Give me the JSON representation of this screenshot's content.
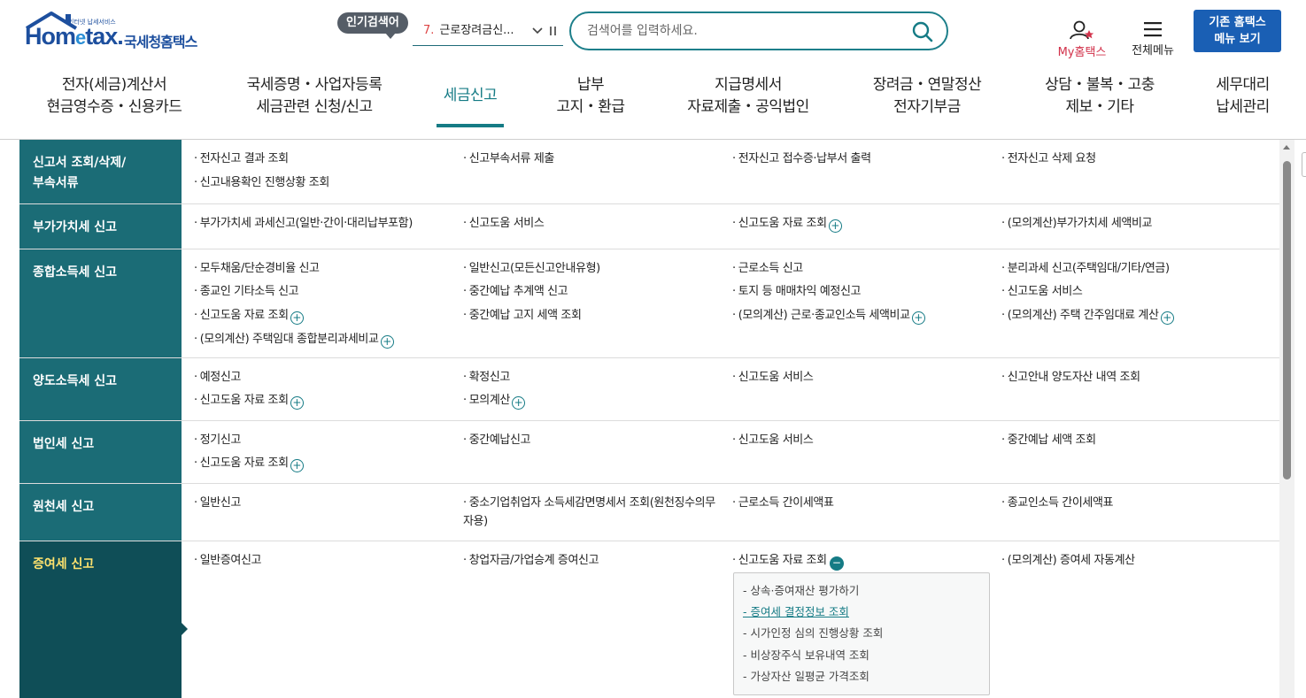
{
  "header": {
    "logo_tag": "인터넷 납세서비스",
    "logo_brand_pre": "Hom",
    "logo_brand_e": "e",
    "logo_brand_post": "tax.",
    "logo_org": "국세청홈택스",
    "popular_badge": "인기검색어",
    "popular_rank": "7.",
    "popular_term": "근로장려금신...",
    "search_placeholder": "검색어를 입력하세요.",
    "my_hometax": "My홈택스",
    "all_menu": "전체메뉴",
    "old_menu_line1": "기존 홈택스",
    "old_menu_line2": "메뉴 보기",
    "colors": {
      "brand": "#1d4f9e",
      "teal": "#157b85",
      "button": "#1a5fb4"
    }
  },
  "gnb": [
    {
      "line1": "전자(세금)계산서",
      "line2": "현금영수증・신용카드"
    },
    {
      "line1": "국세증명・사업자등록",
      "line2": "세금관련 신청/신고"
    },
    {
      "line1": "세금신고",
      "line2": ""
    },
    {
      "line1": "납부",
      "line2": "고지・환급"
    },
    {
      "line1": "지급명세서",
      "line2": "자료제출・공익법인"
    },
    {
      "line1": "장려금・연말정산",
      "line2": "전자기부금"
    },
    {
      "line1": "상담・불복・고충",
      "line2": "제보・기타"
    },
    {
      "line1": "세무대리",
      "line2": "납세관리"
    }
  ],
  "rows": [
    {
      "category": "신고서 조회/삭제/\n부속서류",
      "links": [
        "전자신고 결과 조회",
        "신고부속서류 제출",
        "전자신고 접수증·납부서 출력",
        "전자신고 삭제 요청",
        "신고내용확인 진행상황 조회"
      ]
    },
    {
      "category": "부가가치세 신고",
      "links": [
        "부가가치세 과세신고(일반·간이·대리납부포함)",
        "신고도움 서비스",
        "신고도움 자료 조회",
        "(모의계산)부가가치세 세액비교"
      ]
    },
    {
      "category": "종합소득세 신고",
      "links": [
        "모두채움/단순경비율 신고",
        "일반신고(모든신고안내유형)",
        "근로소득 신고",
        "분리과세 신고(주택임대/기타/연금)",
        "종교인 기타소득 신고",
        "중간예납 추계액 신고",
        "토지 등 매매차익 예정신고",
        "신고도움 서비스",
        "신고도움 자료 조회",
        "중간예납 고지 세액 조회",
        "(모의계산) 근로·종교인소득 세액비교",
        "(모의계산) 주택 간주임대료 계산",
        "(모의계산) 주택임대 종합분리과세비교"
      ]
    },
    {
      "category": "양도소득세 신고",
      "links": [
        "예정신고",
        "확정신고",
        "신고도움 서비스",
        "신고안내 양도자산 내역 조회",
        "신고도움 자료 조회",
        "모의계산"
      ]
    },
    {
      "category": "법인세 신고",
      "links": [
        "정기신고",
        "중간예납신고",
        "신고도움 서비스",
        "중간예납 세액 조회",
        "신고도움 자료 조회"
      ]
    },
    {
      "category": "원천세 신고",
      "links": [
        "일반신고",
        "중소기업취업자 소득세감면명세서 조회(원천징수의무자용)",
        "근로소득 간이세액표",
        "종교인소득 간이세액표"
      ]
    },
    {
      "category": "증여세 신고",
      "links": [
        "일반증여신고",
        "창업자금/가업승계 증여신고",
        "신고도움 자료 조회",
        "(모의계산) 증여세 자동계산"
      ],
      "sub_items": [
        "상속·증여재산 평가하기",
        "증여세 결정정보 조회",
        "시가인정 심의 진행상황 조회",
        "비상장주식 보유내역 조회",
        "가상자산 일평균 가격조회"
      ],
      "active_sub": "증여세 결정정보 조회"
    }
  ]
}
